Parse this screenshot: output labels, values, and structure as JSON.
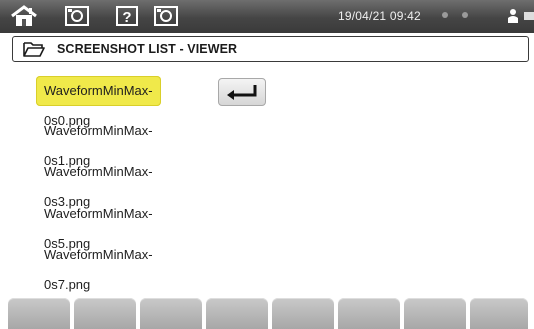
{
  "status_bar": {
    "datetime": "19/04/21 09:42",
    "icons": [
      "home-icon",
      "photo-icon",
      "help-icon",
      "photo-icon",
      "person-icon",
      "battery-icon"
    ]
  },
  "header": {
    "title": "SCREENSHOT LIST - VIEWER",
    "icon": "folder-icon"
  },
  "files": [
    {
      "name": "WaveformMinMax-0s0.png",
      "selected": true
    },
    {
      "name": "WaveformMinMax-0s1.png",
      "selected": false
    },
    {
      "name": "WaveformMinMax-0s3.png",
      "selected": false
    },
    {
      "name": "WaveformMinMax-0s5.png",
      "selected": false
    },
    {
      "name": "WaveformMinMax-0s7.png",
      "selected": false
    }
  ],
  "enter_button": {
    "icon": "enter-icon"
  },
  "colors": {
    "topbar": "#454545",
    "selection": "#f0e94a",
    "function_key": "#b8b8b8"
  },
  "function_keys": [
    "",
    "",
    "",
    "",
    "",
    "",
    "",
    ""
  ]
}
